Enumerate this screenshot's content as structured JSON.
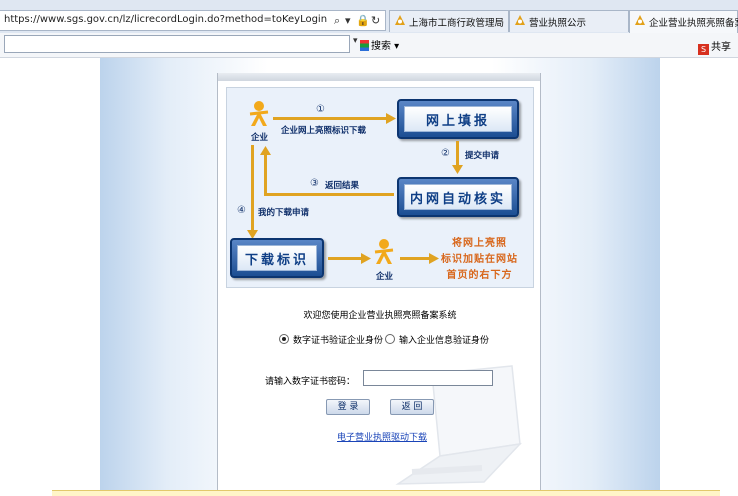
{
  "browser": {
    "url": "https://www.sgs.gov.cn/lz/licrecordLogin.do?method=toKeyLogin",
    "tabs": [
      {
        "label": "上海市工商行政管理局"
      },
      {
        "label": "营业执照公示"
      },
      {
        "label": "企业营业执照亮照备案"
      }
    ],
    "search_label": "搜索",
    "share_label": "共享",
    "share_icon_text": "S"
  },
  "diagram": {
    "enterprise": "企业",
    "step1": "①",
    "step1_label": "企业网上亮照标识下载",
    "box_online_fill": "网上填报",
    "step2": "②",
    "step2_label": "提交申请",
    "box_intranet_verify": "内网自动核实",
    "step3": "③",
    "step3_label": "返回结果",
    "step4": "④",
    "step4_label": "我的下载申请",
    "box_download": "下载标识",
    "enterprise2": "企业",
    "paste_line1": "将网上亮照",
    "paste_line2": "标识加贴在网站",
    "paste_line3": "首页的右下方"
  },
  "form": {
    "welcome": "欢迎您使用企业营业执照亮照备案系统",
    "option_cert": "数字证书验证企业身份",
    "option_info": "输入企业信息验证身份",
    "selected": "option_cert",
    "pwd_label": "请输入数字证书密码：",
    "pwd_value": "",
    "login_button": "登 录",
    "back_button": "返 回",
    "driver_link": "电子营业执照驱动下载"
  },
  "colors": {
    "arrow": "#e0a321",
    "box_blue": "#1c4e93",
    "orange_text": "#d8671c"
  }
}
